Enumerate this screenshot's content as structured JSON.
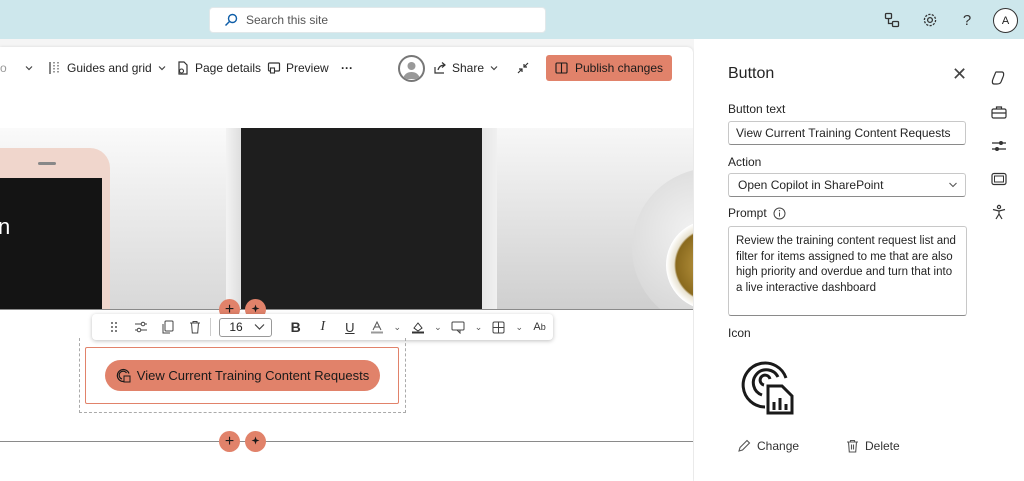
{
  "search": {
    "placeholder": "Search this site"
  },
  "toolbar": {
    "partial_label": "o",
    "guides_label": "Guides and grid",
    "page_details_label": "Page details",
    "preview_label": "Preview",
    "more_label": "···",
    "share_label": "Share",
    "publish_label": "Publish changes"
  },
  "user": {
    "initial": "A"
  },
  "hero": {
    "partial_text": "n"
  },
  "format_toolbar": {
    "font_size": "16",
    "bold": "B",
    "italic": "I",
    "underline": "U"
  },
  "cta_button": {
    "label": "View Current Training Content Requests"
  },
  "panel": {
    "title": "Button",
    "button_text_label": "Button text",
    "button_text_value": "View Current Training Content Requests",
    "action_label": "Action",
    "action_value": "Open Copilot in SharePoint",
    "prompt_label": "Prompt",
    "prompt_value": "Review the training content request list and filter for items assigned to me that are also high priority and overdue and turn that into a live interactive dashboard",
    "icon_label": "Icon",
    "change_label": "Change",
    "delete_label": "Delete"
  },
  "colors": {
    "accent": "#e1826a",
    "suitebar": "#cde7ec"
  }
}
